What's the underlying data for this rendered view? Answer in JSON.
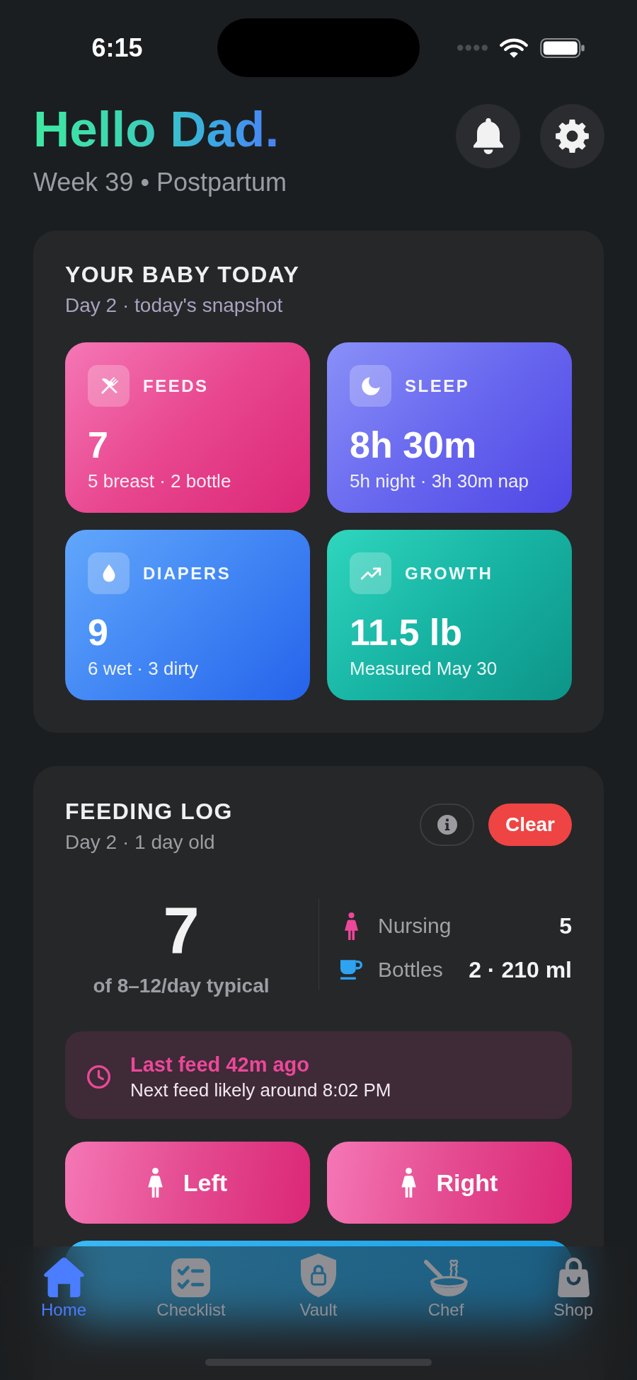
{
  "status_bar": {
    "time": "6:15"
  },
  "header": {
    "title": "Hello Dad.",
    "subtitle": "Week 39 • Postpartum"
  },
  "baby_today": {
    "title": "YOUR BABY TODAY",
    "subtitle": "Day 2 · today's snapshot",
    "tiles": [
      {
        "kind": "feeds",
        "label": "FEEDS",
        "value": "7",
        "detail": "5 breast · 2 bottle"
      },
      {
        "kind": "sleep",
        "label": "SLEEP",
        "value": "8h 30m",
        "detail": "5h night · 3h 30m nap"
      },
      {
        "kind": "diapers",
        "label": "DIAPERS",
        "value": "9",
        "detail": "6 wet · 3 dirty"
      },
      {
        "kind": "growth",
        "label": "GROWTH",
        "value": "11.5 lb",
        "detail": "Measured May 30"
      }
    ]
  },
  "feeding_log": {
    "title": "FEEDING LOG",
    "subtitle": "Day 2 · 1 day old",
    "clear_button": "Clear",
    "total": "7",
    "total_note": "of 8–12/day typical",
    "breakdown": [
      {
        "kind": "nursing",
        "label": "Nursing",
        "value": "5"
      },
      {
        "kind": "bottles",
        "label": "Bottles",
        "value": "2 · 210 ml"
      }
    ],
    "last_feed": {
      "title": "Last feed 42m ago",
      "note": "Next feed likely around 8:02 PM"
    },
    "actions": [
      {
        "kind": "breast",
        "label": "Left"
      },
      {
        "kind": "breast",
        "label": "Right"
      },
      {
        "kind": "wide"
      }
    ]
  },
  "tab_bar": {
    "items": [
      {
        "kind": "home",
        "label": "Home",
        "selected": true
      },
      {
        "kind": "checklist",
        "label": "Checklist",
        "selected": false
      },
      {
        "kind": "vault",
        "label": "Vault",
        "selected": false
      },
      {
        "kind": "chef",
        "label": "Chef",
        "selected": false
      },
      {
        "kind": "shop",
        "label": "Shop",
        "selected": false
      }
    ]
  }
}
